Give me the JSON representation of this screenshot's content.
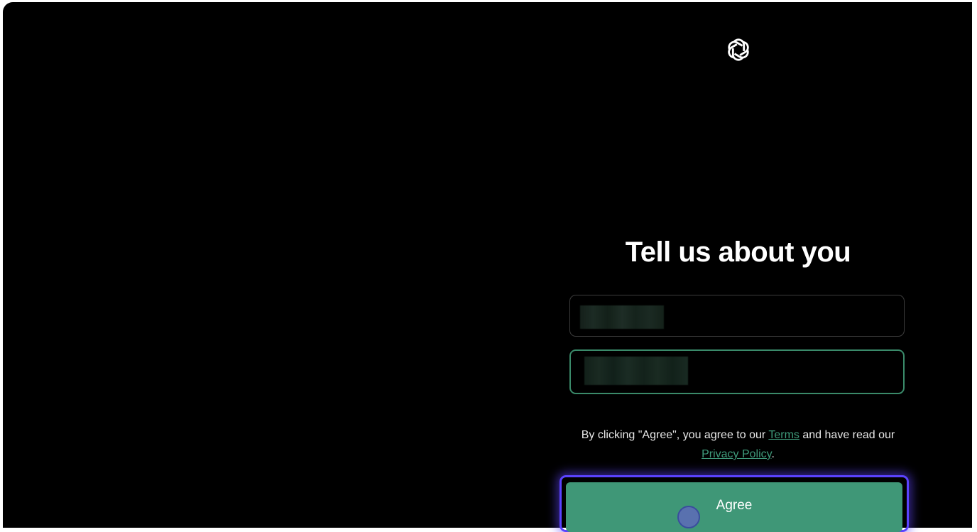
{
  "brand": {
    "logo_icon": "openai-logo-icon"
  },
  "form": {
    "title": "Tell us about you",
    "name_field": {
      "value": "",
      "redacted": true
    },
    "birthday_field": {
      "value": "",
      "redacted": true
    },
    "legal": {
      "prefix": "By clicking \"Agree\", you agree to our ",
      "terms_link": "Terms",
      "middle": " and have read our ",
      "privacy_link": "Privacy Policy",
      "suffix": "."
    },
    "agree_button": "Agree"
  },
  "colors": {
    "background": "#000000",
    "accent": "#3f9777",
    "focus_ring": "#5b43ff",
    "link": "#3f9b7b"
  }
}
